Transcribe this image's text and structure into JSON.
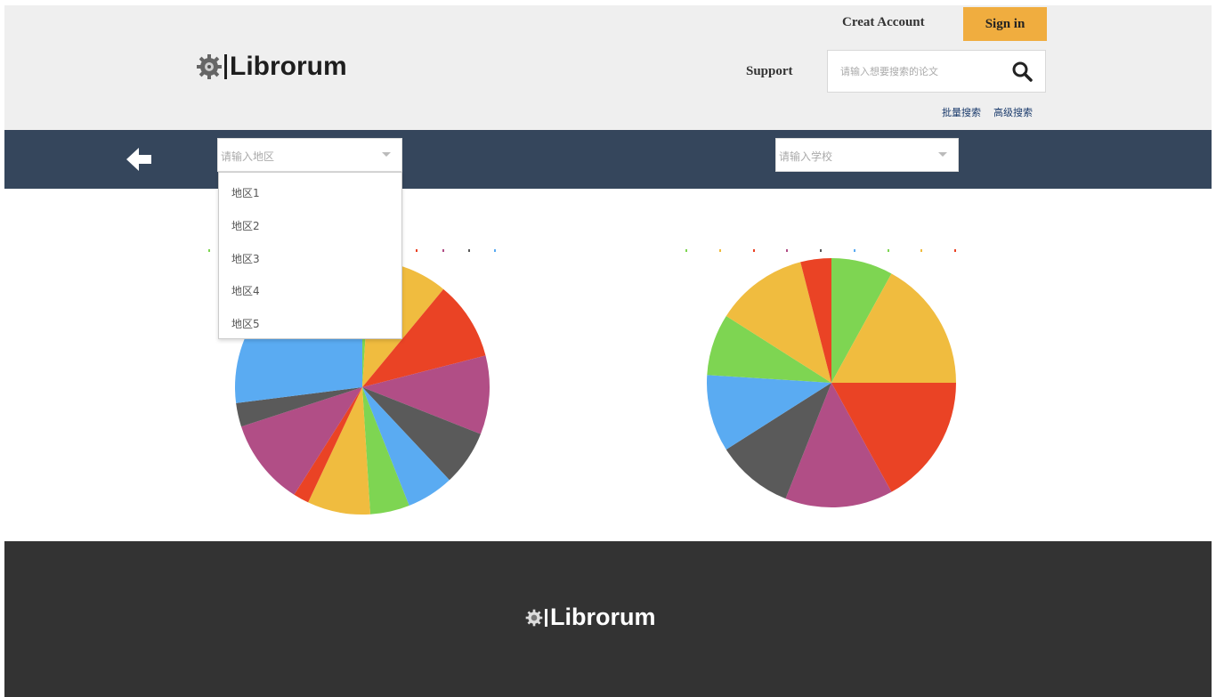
{
  "brand": {
    "name": "Librorum"
  },
  "header": {
    "creat_account": "Creat Account",
    "sign_in": "Sign in",
    "support": "Support",
    "search_placeholder": "请输入想要搜索的论文",
    "bulk_search": "批量搜索",
    "advanced_search": "高级搜索"
  },
  "filters": {
    "region_placeholder": "请输入地区",
    "school_placeholder": "请输入学校",
    "region_options": [
      "地区1",
      "地区2",
      "地区3",
      "地区4",
      "地区5"
    ]
  },
  "icons": {
    "logo": "gear-icon",
    "search": "magnifier-icon",
    "back": "arrow-left-icon"
  },
  "colors": {
    "accent": "#f0ad3f",
    "navbar": "#35465c",
    "footer": "#333333",
    "header_bg": "#efefef"
  },
  "chart_data": [
    {
      "type": "pie",
      "legend": "top",
      "slices": [
        {
          "label": "green",
          "value": 1,
          "color": "#7ed552"
        },
        {
          "label": "yellow",
          "value": 10,
          "color": "#f0bc3f"
        },
        {
          "label": "red",
          "value": 10,
          "color": "#ea4325"
        },
        {
          "label": "magenta",
          "value": 10,
          "color": "#b14e86"
        },
        {
          "label": "gray",
          "value": 7,
          "color": "#5a5a5a"
        },
        {
          "label": "blue",
          "value": 6,
          "color": "#5aabf2"
        },
        {
          "label": "green2",
          "value": 5,
          "color": "#7ed552"
        },
        {
          "label": "yellow2",
          "value": 8,
          "color": "#f0bc3f"
        },
        {
          "label": "red2",
          "value": 2,
          "color": "#ea4325"
        },
        {
          "label": "magenta2",
          "value": 11,
          "color": "#b14e86"
        },
        {
          "label": "gray2",
          "value": 3,
          "color": "#5a5a5a"
        },
        {
          "label": "blue2",
          "value": 27,
          "color": "#5aabf2"
        }
      ]
    },
    {
      "type": "pie",
      "legend": "top",
      "slices": [
        {
          "label": "green",
          "value": 8,
          "color": "#7ed552"
        },
        {
          "label": "yellow",
          "value": 17,
          "color": "#f0bc3f"
        },
        {
          "label": "red",
          "value": 17,
          "color": "#ea4325"
        },
        {
          "label": "magenta",
          "value": 14,
          "color": "#b14e86"
        },
        {
          "label": "gray",
          "value": 10,
          "color": "#5a5a5a"
        },
        {
          "label": "blue",
          "value": 10,
          "color": "#5aabf2"
        },
        {
          "label": "green2",
          "value": 8,
          "color": "#7ed552"
        },
        {
          "label": "yellow2",
          "value": 12,
          "color": "#f0bc3f"
        },
        {
          "label": "red2",
          "value": 4,
          "color": "#ea4325"
        }
      ]
    }
  ]
}
